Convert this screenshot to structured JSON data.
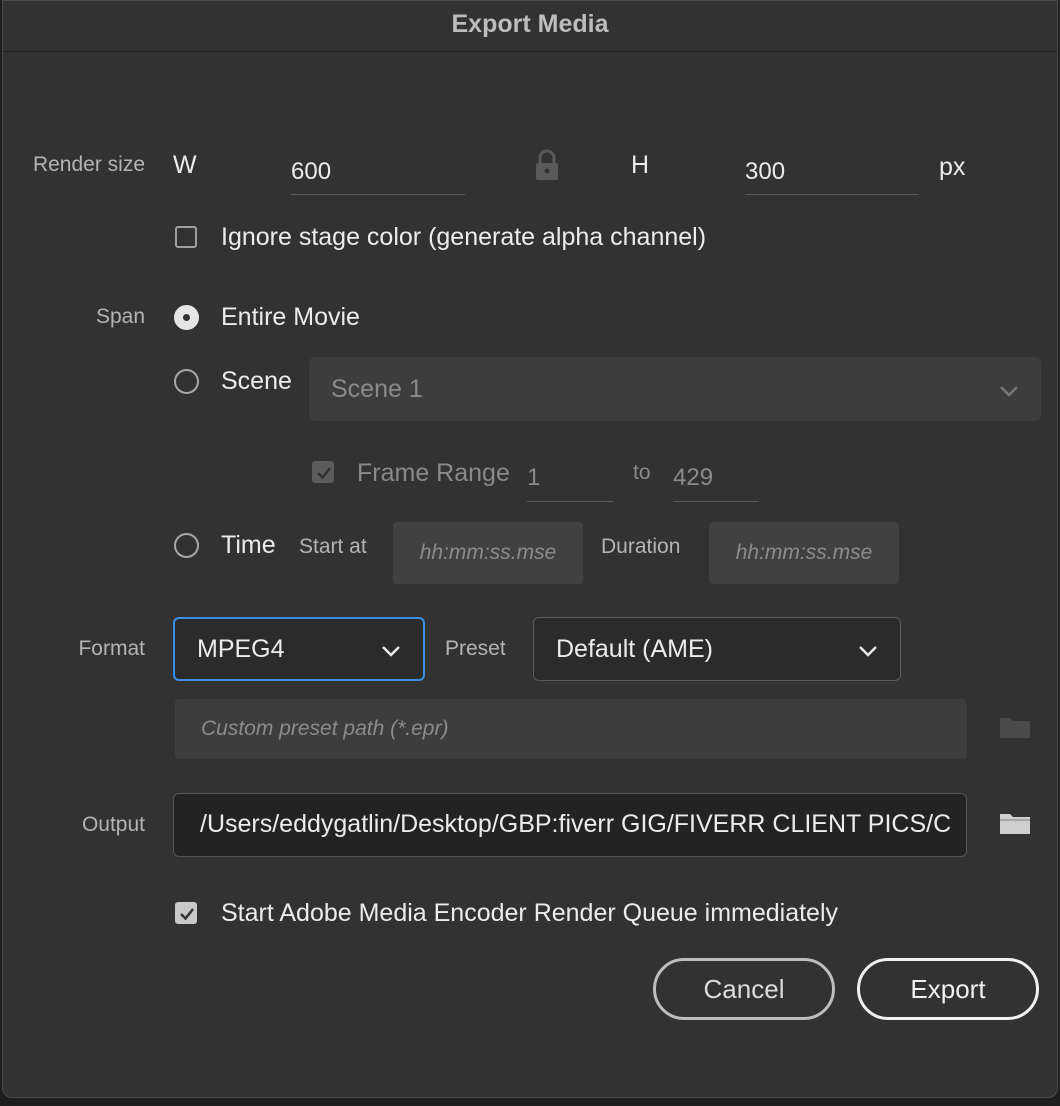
{
  "window": {
    "title": "Export Media"
  },
  "render_size": {
    "label": "Render size",
    "w_label": "W",
    "width": "600",
    "h_label": "H",
    "height": "300",
    "unit": "px"
  },
  "alpha": {
    "label": "Ignore stage color (generate alpha channel)",
    "checked": false
  },
  "span": {
    "label": "Span",
    "entire_movie": "Entire Movie",
    "scene": "Scene",
    "scene_select": "Scene 1",
    "frame_range_label": "Frame Range",
    "frame_from": "1",
    "to_label": "to",
    "frame_to": "429",
    "time": "Time",
    "start_at_label": "Start at",
    "start_placeholder": "hh:mm:ss.mse",
    "duration_label": "Duration",
    "duration_placeholder": "hh:mm:ss.mse",
    "selected": "Entire Movie"
  },
  "format": {
    "label": "Format",
    "value": "MPEG4",
    "preset_label": "Preset",
    "preset_value": "Default (AME)",
    "custom_path_placeholder": "Custom preset path (*.epr)"
  },
  "output": {
    "label": "Output",
    "path": "/Users/eddygatlin/Desktop/GBP:fiverr GIG/FIVERR CLIENT PICS/C"
  },
  "queue": {
    "label": "Start Adobe Media Encoder Render Queue immediately",
    "checked": true
  },
  "buttons": {
    "cancel": "Cancel",
    "export": "Export"
  },
  "colors": {
    "accent": "#3b8fe0",
    "background": "#323232"
  }
}
